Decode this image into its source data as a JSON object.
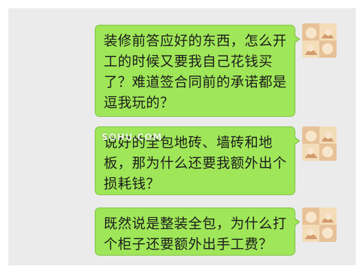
{
  "chat": {
    "messages": [
      {
        "text": "装修前答应好的东西，怎么开工的时候又要我自己花钱买了？难道签合同前的承诺都是逗我玩的？",
        "from": "self"
      },
      {
        "text": "说好的全包地砖、墙砖和地板，那为什么还要我额外出个损耗钱？",
        "from": "self"
      },
      {
        "text": "既然说是整装全包，为什么打个柜子还要额外出手工费？",
        "from": "self"
      }
    ]
  },
  "watermark": {
    "text": "SOHU.COM"
  },
  "colors": {
    "bubble": "#9fe658",
    "bubble_border": "#7fc145",
    "chat_background": "#ebebeb",
    "text": "#1c1c1c"
  },
  "icons": {
    "avatar": "user-avatar-photo"
  }
}
